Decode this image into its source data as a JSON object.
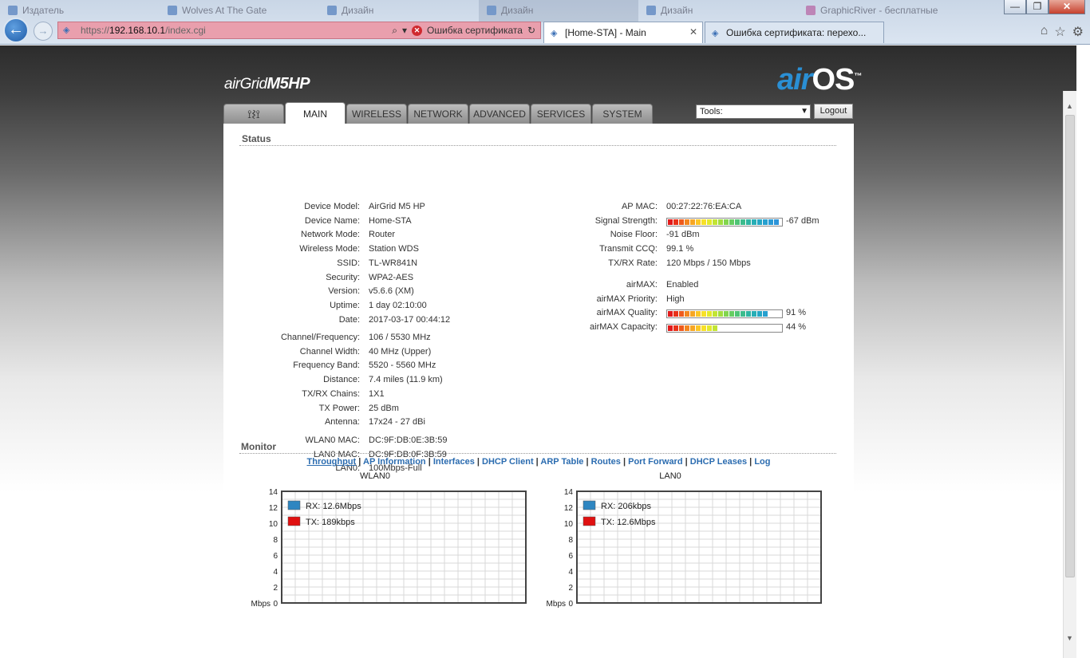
{
  "browser": {
    "ghost_tabs": [
      "Издатель",
      "Wolves At The Gate",
      "Дизайн",
      "Дизайн",
      "Дизайн",
      "GraphicRiver - бесплатные"
    ],
    "address": {
      "proto": "https://",
      "host": "192.168.10.1",
      "path": "/index.cgi",
      "cert_error": "Ошибка сертификата"
    },
    "tabs": [
      {
        "label": "[Home-STA] - Main",
        "active": true
      },
      {
        "label": "Ошибка сертификата: перехо...",
        "active": false
      }
    ],
    "win_controls": {
      "minimize": "—",
      "maximize": "❐",
      "close": "✕"
    }
  },
  "header": {
    "brand_prefix": "airGrid",
    "brand_model": "M5HP",
    "airos_air": "air",
    "airos_os": "OS",
    "airos_tm": "™",
    "tabs": [
      "MAIN",
      "WIRELESS",
      "NETWORK",
      "ADVANCED",
      "SERVICES",
      "SYSTEM"
    ],
    "tools_label": "Tools:",
    "logout_label": "Logout"
  },
  "status": {
    "title": "Status",
    "left_group1": [
      {
        "k": "Device Model:",
        "v": "AirGrid M5 HP"
      },
      {
        "k": "Device Name:",
        "v": "Home-STA"
      },
      {
        "k": "Network Mode:",
        "v": "Router"
      },
      {
        "k": "Wireless Mode:",
        "v": "Station WDS"
      },
      {
        "k": "SSID:",
        "v": "TL-WR841N"
      },
      {
        "k": "Security:",
        "v": "WPA2-AES"
      },
      {
        "k": "Version:",
        "v": "v5.6.6 (XM)"
      },
      {
        "k": "Uptime:",
        "v": "1 day 02:10:00"
      },
      {
        "k": "Date:",
        "v": "2017-03-17 00:44:12"
      }
    ],
    "left_group2": [
      {
        "k": "Channel/Frequency:",
        "v": "106 / 5530 MHz"
      },
      {
        "k": "Channel Width:",
        "v": "40 MHz (Upper)"
      },
      {
        "k": "Frequency Band:",
        "v": "5520 - 5560 MHz"
      },
      {
        "k": "Distance:",
        "v": "7.4 miles (11.9 km)"
      },
      {
        "k": "TX/RX Chains:",
        "v": "1X1"
      },
      {
        "k": "TX Power:",
        "v": "25 dBm"
      },
      {
        "k": "Antenna:",
        "v": "17x24 - 27 dBi"
      }
    ],
    "left_group3": [
      {
        "k": "WLAN0 MAC:",
        "v": "DC:9F:DB:0E:3B:59"
      },
      {
        "k": "LAN0 MAC:",
        "v": "DC:9F:DB:0F:3B:59"
      },
      {
        "k": "LAN0:",
        "v": "100Mbps-Full"
      }
    ],
    "right_group1": [
      {
        "k": "AP MAC:",
        "v": "00:27:22:76:EA:CA"
      },
      {
        "k": "Signal Strength:",
        "v": "-67 dBm",
        "meter": 1.0
      },
      {
        "k": "Noise Floor:",
        "v": "-91 dBm"
      },
      {
        "k": "Transmit CCQ:",
        "v": "99.1 %"
      },
      {
        "k": "TX/RX Rate:",
        "v": "120 Mbps / 150 Mbps"
      }
    ],
    "right_group2": [
      {
        "k": "airMAX:",
        "v": "Enabled"
      },
      {
        "k": "airMAX Priority:",
        "v": "High"
      },
      {
        "k": "airMAX Quality:",
        "v": "91 %",
        "meter": 0.91
      },
      {
        "k": "airMAX Capacity:",
        "v": "44 %",
        "meter": 0.44
      }
    ]
  },
  "monitor": {
    "title": "Monitor",
    "links": [
      "Throughput",
      "AP Information",
      "Interfaces",
      "DHCP Client",
      "ARP Table",
      "Routes",
      "Port Forward",
      "DHCP Leases",
      "Log"
    ],
    "active_link": "Throughput"
  },
  "chart_data": [
    {
      "type": "line",
      "title": "WLAN0",
      "ylabel": "Mbps",
      "ylim": [
        0,
        14
      ],
      "yticks": [
        0,
        2,
        4,
        6,
        8,
        10,
        12,
        14
      ],
      "grid": true,
      "legend": "top-left",
      "series": [
        {
          "name": "RX: 12.6Mbps",
          "color": "#2e86c1",
          "values": []
        },
        {
          "name": "TX: 189kbps",
          "color": "#e01010",
          "values": []
        }
      ]
    },
    {
      "type": "line",
      "title": "LAN0",
      "ylabel": "Mbps",
      "ylim": [
        0,
        14
      ],
      "yticks": [
        0,
        2,
        4,
        6,
        8,
        10,
        12,
        14
      ],
      "grid": true,
      "legend": "top-left",
      "series": [
        {
          "name": "RX: 206kbps",
          "color": "#2e86c1",
          "values": []
        },
        {
          "name": "TX: 12.6Mbps",
          "color": "#e01010",
          "values": []
        }
      ]
    }
  ]
}
